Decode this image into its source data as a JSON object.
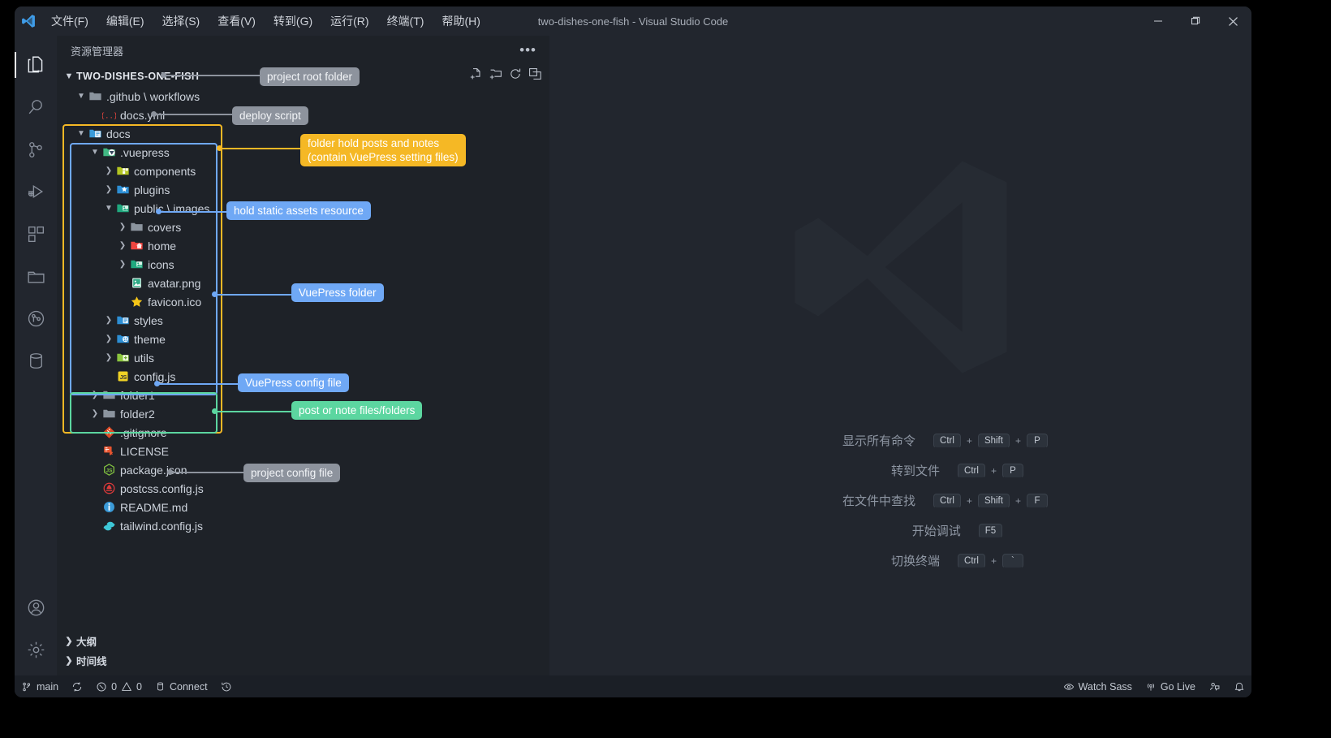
{
  "window": {
    "title": "two-dishes-one-fish - Visual Studio Code",
    "logo_icon": "vscode-logo-icon",
    "minimize_icon": "minimize-icon",
    "maximize_icon": "maximize-icon",
    "close_icon": "close-icon"
  },
  "menubar": {
    "items": [
      {
        "label": "文件(F)",
        "name": "menu-file"
      },
      {
        "label": "编辑(E)",
        "name": "menu-edit"
      },
      {
        "label": "选择(S)",
        "name": "menu-selection"
      },
      {
        "label": "查看(V)",
        "name": "menu-view"
      },
      {
        "label": "转到(G)",
        "name": "menu-go"
      },
      {
        "label": "运行(R)",
        "name": "menu-run"
      },
      {
        "label": "终端(T)",
        "name": "menu-terminal"
      },
      {
        "label": "帮助(H)",
        "name": "menu-help"
      }
    ]
  },
  "activitybar": {
    "items": [
      {
        "name": "activity-explorer",
        "icon": "files-icon",
        "active": true
      },
      {
        "name": "activity-search",
        "icon": "search-icon",
        "active": false
      },
      {
        "name": "activity-source-control",
        "icon": "source-control-icon",
        "active": false
      },
      {
        "name": "activity-run-debug",
        "icon": "run-and-debug-icon",
        "active": false
      },
      {
        "name": "activity-extensions",
        "icon": "extensions-icon",
        "active": false
      },
      {
        "name": "activity-project-manager",
        "icon": "folder-icon",
        "active": false
      },
      {
        "name": "activity-git-graph",
        "icon": "git-graph-icon",
        "active": false
      },
      {
        "name": "activity-database",
        "icon": "database-icon",
        "active": false
      }
    ],
    "bottom": [
      {
        "name": "activity-accounts",
        "icon": "account-icon"
      },
      {
        "name": "activity-settings",
        "icon": "gear-icon"
      }
    ]
  },
  "sidebar": {
    "title": "资源管理器",
    "more_actions_icon": "ellipsis-icon",
    "root": {
      "label": "TWO-DISHES-ONE-FISH",
      "expanded": true,
      "actions": [
        {
          "name": "new-file-button",
          "icon": "new-file-icon"
        },
        {
          "name": "new-folder-button",
          "icon": "new-folder-icon"
        },
        {
          "name": "refresh-explorer-button",
          "icon": "refresh-icon"
        },
        {
          "name": "collapse-folders-button",
          "icon": "collapse-all-icon"
        }
      ]
    },
    "tree": [
      {
        "label": ".github \\ workflows",
        "icon": "folder-open-icon",
        "indent": 1,
        "arrow": "down",
        "type": "folder",
        "name": "tree-item-github-workflows"
      },
      {
        "label": "docs.yml",
        "icon": "yaml-icon",
        "indent": 2,
        "arrow": "none",
        "type": "file",
        "name": "tree-item-docs-yml"
      },
      {
        "label": "docs",
        "icon": "folder-docs-icon",
        "indent": 1,
        "arrow": "down",
        "type": "folder",
        "name": "tree-item-docs"
      },
      {
        "label": ".vuepress",
        "icon": "folder-vuepress-icon",
        "indent": 2,
        "arrow": "down",
        "type": "folder",
        "name": "tree-item-vuepress"
      },
      {
        "label": "components",
        "icon": "folder-components-icon",
        "indent": 3,
        "arrow": "right",
        "type": "folder",
        "name": "tree-item-components"
      },
      {
        "label": "plugins",
        "icon": "folder-plugins-icon",
        "indent": 3,
        "arrow": "right",
        "type": "folder",
        "name": "tree-item-plugins"
      },
      {
        "label": "public \\ images",
        "icon": "folder-public-icon",
        "indent": 3,
        "arrow": "down",
        "type": "folder",
        "name": "tree-item-public-images"
      },
      {
        "label": "covers",
        "icon": "folder-plain-icon",
        "indent": 4,
        "arrow": "right",
        "type": "folder",
        "name": "tree-item-covers"
      },
      {
        "label": "home",
        "icon": "folder-home-icon",
        "indent": 4,
        "arrow": "right",
        "type": "folder",
        "name": "tree-item-home"
      },
      {
        "label": "icons",
        "icon": "folder-images-icon",
        "indent": 4,
        "arrow": "right",
        "type": "folder",
        "name": "tree-item-icons"
      },
      {
        "label": "avatar.png",
        "icon": "image-file-icon",
        "indent": 4,
        "arrow": "none",
        "type": "file",
        "name": "tree-item-avatar-png"
      },
      {
        "label": "favicon.ico",
        "icon": "favicon-star-icon",
        "indent": 4,
        "arrow": "none",
        "type": "file",
        "name": "tree-item-favicon-ico"
      },
      {
        "label": "styles",
        "icon": "folder-styles-icon",
        "indent": 3,
        "arrow": "right",
        "type": "folder",
        "name": "tree-item-styles"
      },
      {
        "label": "theme",
        "icon": "folder-theme-icon",
        "indent": 3,
        "arrow": "right",
        "type": "folder",
        "name": "tree-item-theme"
      },
      {
        "label": "utils",
        "icon": "folder-utils-icon",
        "indent": 3,
        "arrow": "right",
        "type": "folder",
        "name": "tree-item-utils"
      },
      {
        "label": "config.js",
        "icon": "javascript-icon",
        "indent": 3,
        "arrow": "none",
        "type": "file",
        "name": "tree-item-config-js"
      },
      {
        "label": "folder1",
        "icon": "folder-plain-icon",
        "indent": 2,
        "arrow": "right",
        "type": "folder",
        "name": "tree-item-folder1"
      },
      {
        "label": "folder2",
        "icon": "folder-plain-icon",
        "indent": 2,
        "arrow": "right",
        "type": "folder",
        "name": "tree-item-folder2"
      },
      {
        "label": ".gitignore",
        "icon": "git-icon",
        "indent": 2,
        "arrow": "none",
        "type": "file",
        "name": "tree-item-gitignore"
      },
      {
        "label": "LICENSE",
        "icon": "license-icon",
        "indent": 2,
        "arrow": "none",
        "type": "file",
        "name": "tree-item-license"
      },
      {
        "label": "package.json",
        "icon": "nodejs-icon",
        "indent": 2,
        "arrow": "none",
        "type": "file",
        "name": "tree-item-package-json"
      },
      {
        "label": "postcss.config.js",
        "icon": "postcss-icon",
        "indent": 2,
        "arrow": "none",
        "type": "file",
        "name": "tree-item-postcss-config-js"
      },
      {
        "label": "README.md",
        "icon": "readme-icon",
        "indent": 2,
        "arrow": "none",
        "type": "file",
        "name": "tree-item-readme-md"
      },
      {
        "label": "tailwind.config.js",
        "icon": "tailwind-icon",
        "indent": 2,
        "arrow": "none",
        "type": "file",
        "name": "tree-item-tailwind-config-js"
      }
    ],
    "panels": [
      {
        "label": "大纲",
        "name": "sidebar-panel-outline"
      },
      {
        "label": "时间线",
        "name": "sidebar-panel-timeline"
      }
    ]
  },
  "editor": {
    "watermark_icon": "vscode-watermark-icon",
    "shortcuts": [
      {
        "label": "显示所有命令",
        "keys": [
          "Ctrl",
          "Shift",
          "P"
        ],
        "name": "shortcut-show-all-commands"
      },
      {
        "label": "转到文件",
        "keys": [
          "Ctrl",
          "P"
        ],
        "name": "shortcut-go-to-file"
      },
      {
        "label": "在文件中查找",
        "keys": [
          "Ctrl",
          "Shift",
          "F"
        ],
        "name": "shortcut-find-in-files"
      },
      {
        "label": "开始调试",
        "keys": [
          "F5"
        ],
        "name": "shortcut-start-debugging"
      },
      {
        "label": "切换终端",
        "keys": [
          "Ctrl",
          "`"
        ],
        "name": "shortcut-toggle-terminal"
      }
    ],
    "key_separator": "+"
  },
  "statusbar": {
    "left": [
      {
        "label": "main",
        "icon": "source-control-branch-icon",
        "name": "status-branch"
      },
      {
        "label": "",
        "icon": "sync-icon",
        "name": "status-sync"
      },
      {
        "label": "0  0",
        "icon": "error-warning-icon",
        "errors": "0",
        "warnings": "0",
        "name": "status-problems"
      },
      {
        "label": "Connect",
        "icon": "database-connect-icon",
        "name": "status-connect"
      },
      {
        "label": "",
        "icon": "history-icon",
        "name": "status-history"
      }
    ],
    "right": [
      {
        "label": "Watch Sass",
        "icon": "watch-sass-icon",
        "name": "status-watch-sass"
      },
      {
        "label": "Go Live",
        "icon": "broadcast-icon",
        "name": "status-go-live"
      },
      {
        "label": "",
        "icon": "feedback-icon",
        "name": "status-feedback"
      },
      {
        "label": "",
        "icon": "bell-icon",
        "name": "status-notifications"
      }
    ]
  },
  "annotations": {
    "colors": {
      "gray": "#8d939d",
      "yellow": "#f5b825",
      "blue": "#6fa8f5",
      "green": "#5cd6a0"
    },
    "labels": [
      {
        "text": "project root folder",
        "style": "gray",
        "name": "annotation-project-root-folder"
      },
      {
        "text": "deploy script",
        "style": "gray",
        "name": "annotation-deploy-script"
      },
      {
        "text": "folder hold posts and notes\n(contain VuePress setting files)",
        "style": "yellow",
        "name": "annotation-docs-folder"
      },
      {
        "text": "hold static assets resource",
        "style": "blue",
        "name": "annotation-static-assets"
      },
      {
        "text": "VuePress folder",
        "style": "blue",
        "name": "annotation-vuepress-folder"
      },
      {
        "text": "VuePress config file",
        "style": "blue",
        "name": "annotation-vuepress-config-file"
      },
      {
        "text": "post or note files/folders",
        "style": "green",
        "name": "annotation-post-or-note-files"
      },
      {
        "text": "project config file",
        "style": "gray",
        "name": "annotation-project-config-file"
      }
    ]
  }
}
